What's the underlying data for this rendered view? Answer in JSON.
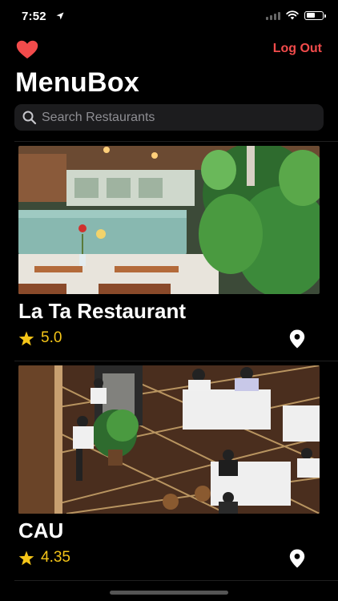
{
  "status": {
    "time": "7:52",
    "battery_level": 0.6
  },
  "header": {
    "logout_label": "Log Out",
    "title": "MenuBox",
    "accent": "#f24b4b"
  },
  "search": {
    "placeholder": "Search Restaurants"
  },
  "restaurants": [
    {
      "name": "La Ta Restaurant",
      "rating": "5.0"
    },
    {
      "name": "CAU",
      "rating": "4.35"
    }
  ],
  "colors": {
    "star": "#f5c518",
    "background": "#000000"
  },
  "icons": [
    "location-arrow-icon",
    "signal-icon",
    "wifi-icon",
    "battery-icon",
    "heart-icon",
    "search-icon",
    "star-icon",
    "map-pin-icon"
  ]
}
